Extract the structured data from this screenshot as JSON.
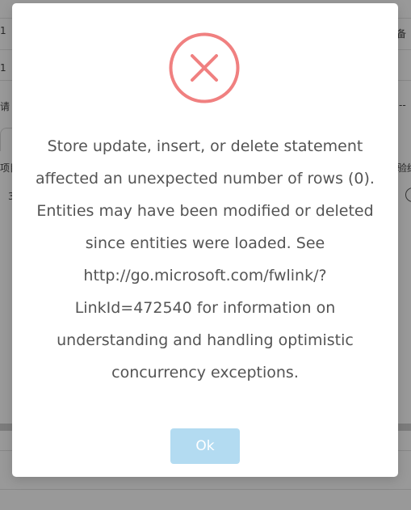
{
  "background": {
    "row_fragments": [
      {
        "left": "1",
        "right": ""
      },
      {
        "left": "",
        "right": "备"
      },
      {
        "left": "1",
        "right": ""
      },
      {
        "left": "请",
        "right": "--"
      },
      {
        "left": "项目",
        "right": "验结"
      },
      {
        "left": "3",
        "right": ""
      }
    ]
  },
  "dialog": {
    "icon": "error-x-circle-icon",
    "icon_color": "#f08080",
    "message": "Store update, insert, or delete statement affected an unexpected number of rows (0). Entities may have been modified or deleted since entities were loaded. See http://go.microsoft.com/fwlink/?LinkId=472540 for information on understanding and handling optimistic concurrency exceptions.",
    "ok_label": "Ok",
    "ok_color": "#b3dbf1"
  }
}
